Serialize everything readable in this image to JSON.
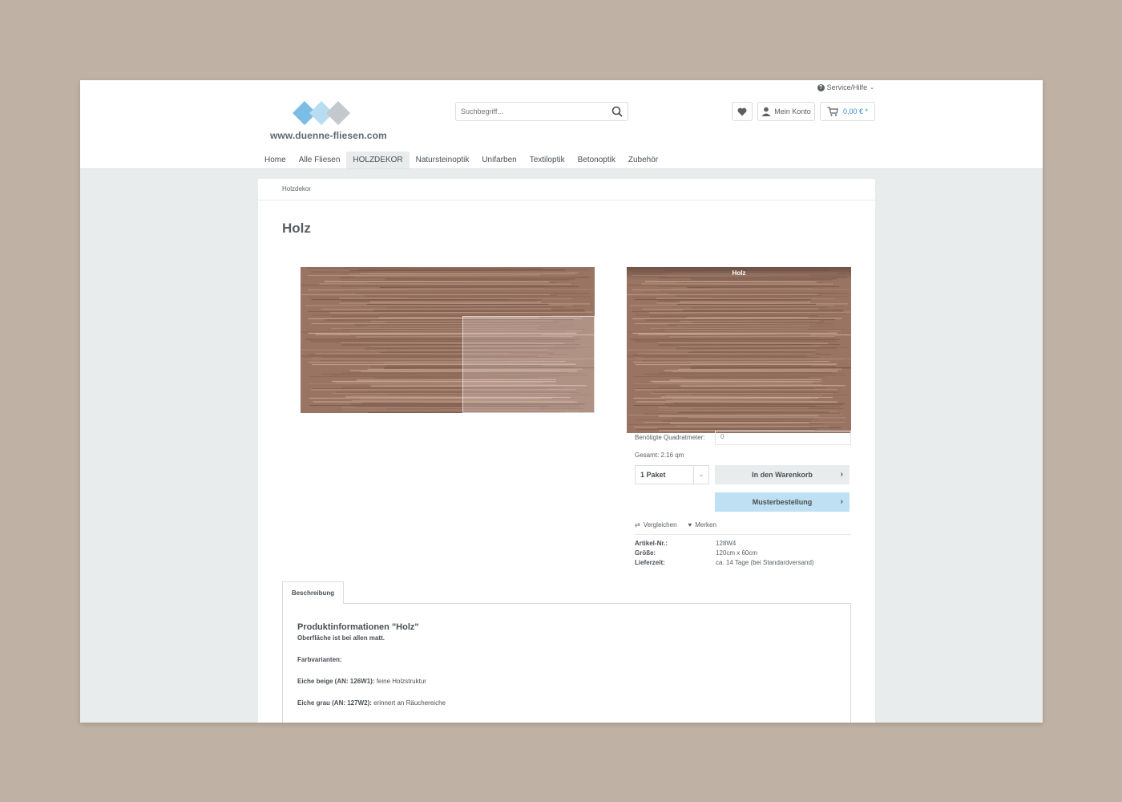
{
  "header": {
    "service_label": "Service/Hilfe",
    "logo_text": "www.duenne-fliesen.com",
    "search_placeholder": "Suchbegriff...",
    "account_label": "Mein Konto",
    "cart_total": "0,00 € *",
    "colors": {
      "accent": "#3a8fd6",
      "logo_blue": "#7cbde6",
      "logo_light": "#b8dcf0",
      "logo_gray": "#c4c9cd"
    }
  },
  "nav": {
    "items": [
      "Home",
      "Alle Fliesen",
      "HOLZDEKOR",
      "Natursteinoptik",
      "Unifarben",
      "Textiloptik",
      "Betonoptik",
      "Zubehör"
    ],
    "active_index": 2
  },
  "breadcrumb": "Holzdekor",
  "product": {
    "title": "Holz",
    "image_label": "Holz",
    "qm_label": "Benötigte Quadratmeter:",
    "qm_value": "0",
    "total": "Gesamt: 2.16 qm",
    "qty_value": "1 Paket",
    "add_to_cart": "In den Warenkorb",
    "sample_order": "Musterbestellung",
    "compare": "Vergleichen",
    "remember": "Merken",
    "attributes": [
      {
        "key": "Artikel-Nr.:",
        "value": "128W4"
      },
      {
        "key": "Größe:",
        "value": "120cm x 60cm"
      },
      {
        "key": "Lieferzeit:",
        "value": "ca. 14 Tage (bei Standardversand)"
      }
    ]
  },
  "tabs": {
    "description": "Beschreibung"
  },
  "description": {
    "heading": "Produktinformationen \"Holz\"",
    "subheading": "Oberfläche ist bei allen matt.",
    "variants_label": "Farbvarianten:",
    "variant1_name": "Eiche beige (AN: 126W1):",
    "variant1_text": " feine Holzstruktur",
    "variant2_name": "Eiche grau (AN: 127W2):",
    "variant2_text": " erinnert an Räuchereiche"
  }
}
